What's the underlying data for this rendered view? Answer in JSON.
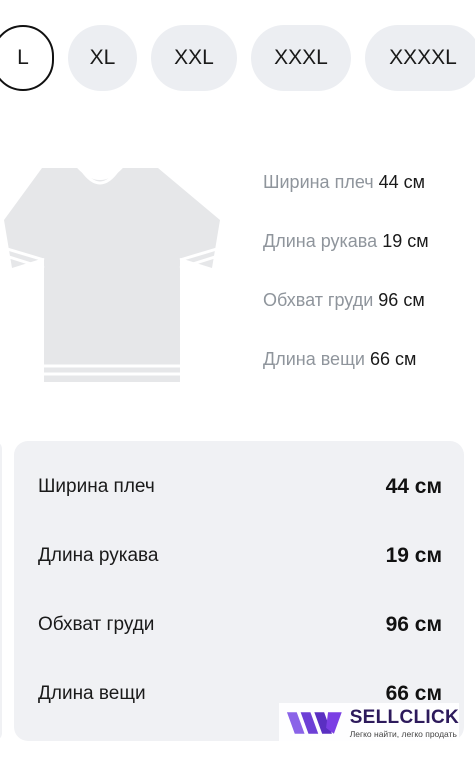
{
  "sizes": {
    "items": [
      "L",
      "XL",
      "XXL",
      "XXXL",
      "XXXXL"
    ],
    "selected": "L"
  },
  "illustration": {
    "measurements": [
      {
        "label": "Ширина плеч",
        "value": "44 см"
      },
      {
        "label": "Длина рукава",
        "value": "19 см"
      },
      {
        "label": "Обхват груди",
        "value": "96 см"
      },
      {
        "label": "Длина вещи",
        "value": "66 см"
      }
    ]
  },
  "table": {
    "rows": [
      {
        "label": "Ширина плеч",
        "value": "44 см"
      },
      {
        "label": "Длина рукава",
        "value": "19 см"
      },
      {
        "label": "Обхват груди",
        "value": "96 см"
      },
      {
        "label": "Длина вещи",
        "value": "66 см"
      }
    ]
  },
  "watermark": {
    "name": "SELLCLICK",
    "tagline": "Легко найти, легко продать"
  },
  "colors": {
    "chip_bg": "#eceef2",
    "card_bg": "#f0f1f4",
    "muted_text": "#8f959c",
    "brand": "#7b3fe4"
  }
}
